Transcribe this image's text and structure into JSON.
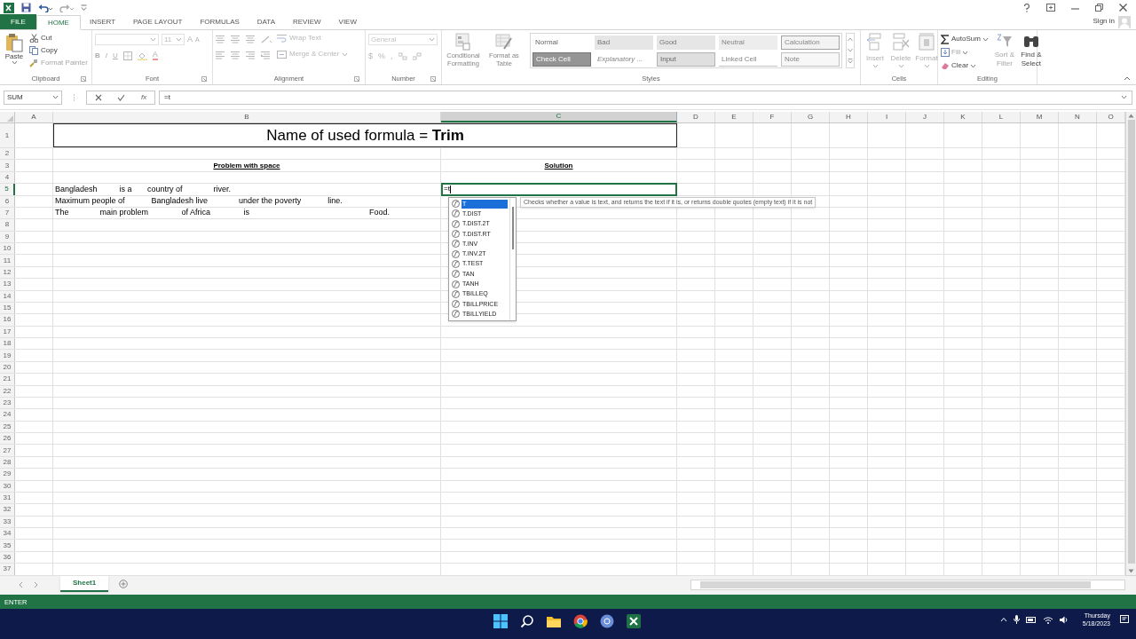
{
  "ribbon_tabs": [
    {
      "label": "FILE",
      "kind": "file",
      "selected": false
    },
    {
      "label": "HOME",
      "kind": "tab",
      "selected": true
    },
    {
      "label": "INSERT",
      "kind": "tab",
      "selected": false
    },
    {
      "label": "PAGE LAYOUT",
      "kind": "tab",
      "selected": false
    },
    {
      "label": "FORMULAS",
      "kind": "tab",
      "selected": false
    },
    {
      "label": "DATA",
      "kind": "tab",
      "selected": false
    },
    {
      "label": "REVIEW",
      "kind": "tab",
      "selected": false
    },
    {
      "label": "VIEW",
      "kind": "tab",
      "selected": false
    }
  ],
  "account": {
    "label": "Sign in"
  },
  "ribbon": {
    "clipboard": {
      "label": "Clipboard",
      "paste": "Paste",
      "commands": [
        {
          "label": "Cut",
          "disabled": false
        },
        {
          "label": "Copy",
          "disabled": false
        },
        {
          "label": "Format Painter",
          "disabled": true
        }
      ]
    },
    "font": {
      "label": "Font",
      "disabled": true,
      "size": "11",
      "grow": "A",
      "shrink": "A",
      "format_buttons": [
        "B",
        "I",
        "U"
      ],
      "color_button": "A"
    },
    "alignment": {
      "label": "Alignment",
      "disabled": true,
      "wrap": "Wrap Text",
      "merge": "Merge & Center"
    },
    "number": {
      "label": "Number",
      "disabled": true,
      "format": "General",
      "symbols": [
        "$",
        "%",
        ","
      ]
    },
    "styles": {
      "label": "Styles",
      "disabled": true,
      "buttons": [
        "Conditional Formatting",
        "Format as Table"
      ],
      "gallery": [
        {
          "label": "Normal",
          "kind": "normal"
        },
        {
          "label": "Bad",
          "kind": "bad"
        },
        {
          "label": "Good",
          "kind": "good"
        },
        {
          "label": "Neutral",
          "kind": "neutral"
        },
        {
          "label": "Calculation",
          "kind": "calculation"
        },
        {
          "label": "Check Cell",
          "kind": "check"
        },
        {
          "label": "Explanatory ...",
          "kind": "explanatory"
        },
        {
          "label": "Input",
          "kind": "input"
        },
        {
          "label": "Linked Cell",
          "kind": "linked"
        },
        {
          "label": "Note",
          "kind": "note"
        }
      ]
    },
    "cells": {
      "label": "Cells",
      "disabled": true,
      "buttons": [
        "Insert",
        "Delete",
        "Format"
      ]
    },
    "editing": {
      "label": "Editing",
      "commands": [
        {
          "label": "AutoSum",
          "disabled": false
        },
        {
          "label": "Fill",
          "disabled": true
        },
        {
          "label": "Clear",
          "disabled": false
        }
      ],
      "buttons": [
        {
          "label": "Sort & Filter",
          "disabled": true
        },
        {
          "label": "Find & Select",
          "disabled": false
        }
      ]
    }
  },
  "formula_bar": {
    "name_box": "SUM",
    "function_button": "fx",
    "formula": "=t"
  },
  "columns": [
    {
      "label": "A",
      "selected": false
    },
    {
      "label": "B",
      "selected": false
    },
    {
      "label": "C",
      "selected": true
    },
    {
      "label": "D",
      "selected": false
    },
    {
      "label": "E",
      "selected": false
    },
    {
      "label": "F",
      "selected": false
    },
    {
      "label": "G",
      "selected": false
    },
    {
      "label": "H",
      "selected": false
    },
    {
      "label": "I",
      "selected": false
    },
    {
      "label": "J",
      "selected": false
    },
    {
      "label": "K",
      "selected": false
    },
    {
      "label": "L",
      "selected": false
    },
    {
      "label": "M",
      "selected": false
    },
    {
      "label": "N",
      "selected": false
    },
    {
      "label": "O",
      "selected": false
    }
  ],
  "rows": [
    {
      "label": "1",
      "selected": false,
      "cells": [
        {
          "kind": "title",
          "text": "Name of used formula = **Trim**"
        }
      ]
    },
    {
      "label": "2",
      "selected": false
    },
    {
      "label": "3",
      "selected": false,
      "cells": [
        {
          "kind": "heading",
          "text": "Problem with space"
        },
        {
          "kind": "heading",
          "text": "Solution"
        }
      ]
    },
    {
      "label": "4",
      "selected": false
    },
    {
      "label": "5",
      "selected": true,
      "cells": [
        {
          "kind": "text",
          "text": "Bangladesh          is a       country of              river."
        },
        {
          "kind": "editing",
          "text": "=t"
        }
      ]
    },
    {
      "label": "6",
      "selected": false,
      "cells": [
        {
          "kind": "text",
          "text": "Maximum people of            Bangladesh live              under the poverty            line."
        }
      ]
    },
    {
      "label": "7",
      "selected": false,
      "cells": [
        {
          "kind": "text",
          "text": "The              main problem               of Africa               is                                                      Food."
        }
      ]
    },
    {
      "label": "8",
      "selected": false
    },
    {
      "label": "9",
      "selected": false
    },
    {
      "label": "10",
      "selected": false
    },
    {
      "label": "11",
      "selected": false
    },
    {
      "label": "12",
      "selected": false
    },
    {
      "label": "13",
      "selected": false
    },
    {
      "label": "14",
      "selected": false
    },
    {
      "label": "15",
      "selected": false
    },
    {
      "label": "16",
      "selected": false
    },
    {
      "label": "17",
      "selected": false
    },
    {
      "label": "18",
      "selected": false
    },
    {
      "label": "19",
      "selected": false
    },
    {
      "label": "20",
      "selected": false
    },
    {
      "label": "21",
      "selected": false
    },
    {
      "label": "22",
      "selected": false
    },
    {
      "label": "23",
      "selected": false
    },
    {
      "label": "24",
      "selected": false
    },
    {
      "label": "25",
      "selected": false
    },
    {
      "label": "26",
      "selected": false
    },
    {
      "label": "27",
      "selected": false
    },
    {
      "label": "28",
      "selected": false
    },
    {
      "label": "29",
      "selected": false
    },
    {
      "label": "30",
      "selected": false
    },
    {
      "label": "31",
      "selected": false
    },
    {
      "label": "32",
      "selected": false
    },
    {
      "label": "33",
      "selected": false
    },
    {
      "label": "34",
      "selected": false
    },
    {
      "label": "35",
      "selected": false
    },
    {
      "label": "36",
      "selected": false
    },
    {
      "label": "37",
      "selected": false
    }
  ],
  "autocomplete": {
    "items": [
      {
        "label": "T",
        "selected": true
      },
      {
        "label": "T.DIST",
        "selected": false
      },
      {
        "label": "T.DIST.2T",
        "selected": false
      },
      {
        "label": "T.DIST.RT",
        "selected": false
      },
      {
        "label": "T.INV",
        "selected": false
      },
      {
        "label": "T.INV.2T",
        "selected": false
      },
      {
        "label": "T.TEST",
        "selected": false
      },
      {
        "label": "TAN",
        "selected": false
      },
      {
        "label": "TANH",
        "selected": false
      },
      {
        "label": "TBILLEQ",
        "selected": false
      },
      {
        "label": "TBILLPRICE",
        "selected": false
      },
      {
        "label": "TBILLYIELD",
        "selected": false
      }
    ],
    "tooltip": "Checks whether a value is text, and returns the text if it is, or returns double quotes (empty text) if it is not"
  },
  "sheet_tabs": [
    {
      "label": "Sheet1",
      "selected": true
    }
  ],
  "status_bar": {
    "mode": "ENTER"
  },
  "taskbar": {
    "day": "Thursday",
    "date": "5/18/2023"
  }
}
